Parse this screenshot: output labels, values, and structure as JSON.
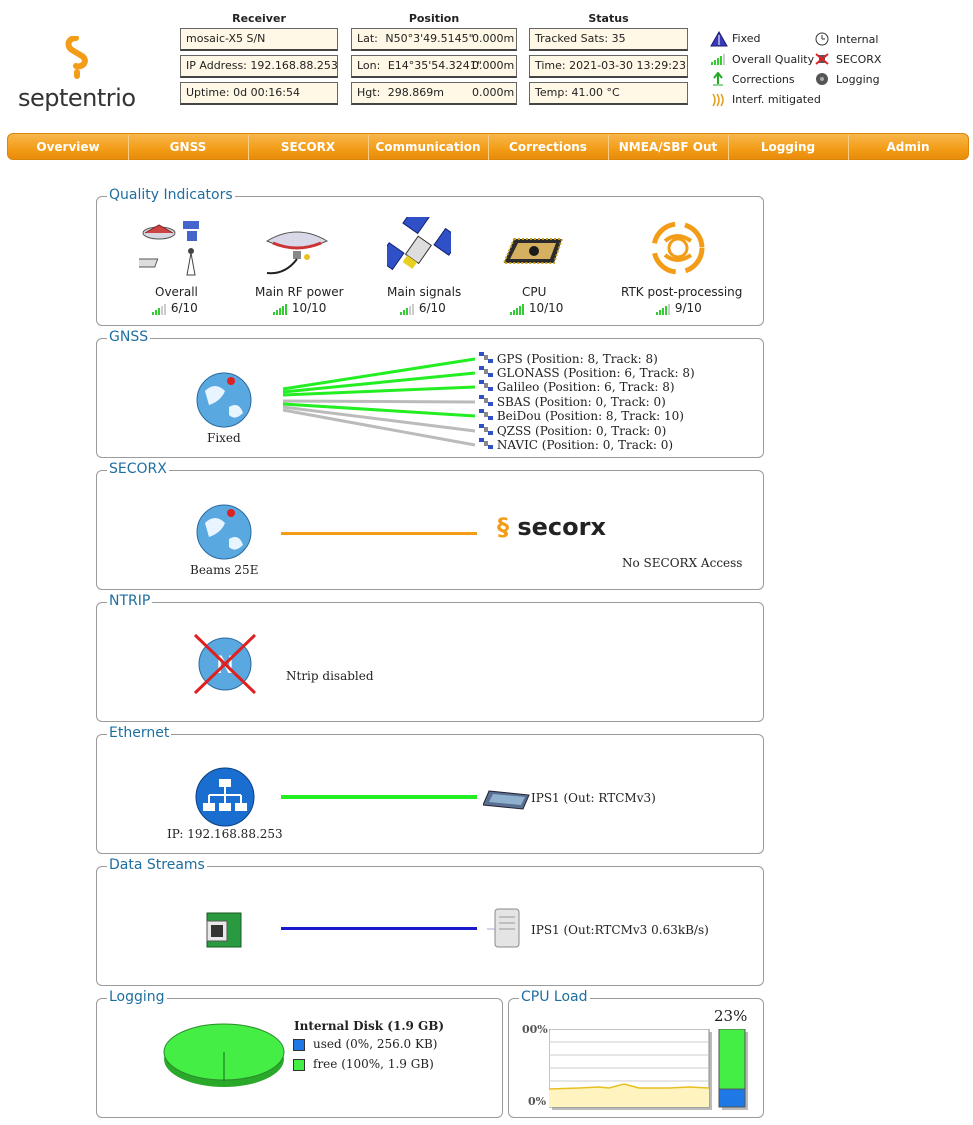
{
  "header": {
    "brand": "septentrio",
    "receiver": {
      "title": "Receiver",
      "rows": [
        "mosaic-X5 S/N",
        "IP Address: 192.168.88.253",
        "Uptime: 0d 00:16:54"
      ]
    },
    "position": {
      "title": "Position",
      "rows": [
        {
          "label": "Lat:",
          "value": "N50°3'49.5145\"",
          "acc": "0.000m"
        },
        {
          "label": "Lon:",
          "value": "E14°35'54.3241\"",
          "acc": "0.000m"
        },
        {
          "label": "Hgt:",
          "value": "298.869m",
          "acc": "0.000m"
        }
      ]
    },
    "status": {
      "title": "Status",
      "rows": [
        "Tracked Sats: 35",
        "Time: 2021-03-30 13:29:23",
        "Temp: 41.00 °C"
      ]
    },
    "legend": {
      "fixed": "Fixed",
      "overall_quality": "Overall Quality",
      "corrections": "Corrections",
      "interf_mitigated": "Interf. mitigated",
      "internal": "Internal",
      "secorx": "SECORX",
      "logging": "Logging"
    }
  },
  "nav": [
    "Overview",
    "GNSS",
    "SECORX",
    "Communication",
    "Corrections",
    "NMEA/SBF Out",
    "Logging",
    "Admin"
  ],
  "quality": {
    "title": "Quality Indicators",
    "items": [
      {
        "label": "Overall",
        "score": "6/10",
        "level": 6
      },
      {
        "label": "Main RF power",
        "score": "10/10",
        "level": 10
      },
      {
        "label": "Main signals",
        "score": "6/10",
        "level": 6
      },
      {
        "label": "CPU",
        "score": "10/10",
        "level": 10
      },
      {
        "label": "RTK post-processing",
        "score": "9/10",
        "level": 9
      }
    ]
  },
  "gnss": {
    "title": "GNSS",
    "mode": "Fixed",
    "constellations": [
      "GPS (Position: 8, Track: 8)",
      "GLONASS (Position: 6, Track: 8)",
      "Galileo (Position: 6, Track: 8)",
      "SBAS (Position: 0, Track: 0)",
      "BeiDou (Position: 8, Track: 10)",
      "QZSS (Position: 0, Track: 0)",
      "NAVIC (Position: 0, Track: 0)"
    ]
  },
  "secorx": {
    "title": "SECORX",
    "beams": "Beams 25E",
    "logo": "secorx",
    "access": "No SECORX Access"
  },
  "ntrip": {
    "title": "NTRIP",
    "status": "Ntrip disabled"
  },
  "ethernet": {
    "title": "Ethernet",
    "ip": "IP: 192.168.88.253",
    "port": "IPS1 (Out: RTCMv3)"
  },
  "streams": {
    "title": "Data Streams",
    "stream": "IPS1 (Out:RTCMv3 0.63kB/s)"
  },
  "logging": {
    "title": "Logging",
    "disk_title": "Internal Disk (1.9 GB)",
    "used": "used (0%, 256.0 KB)",
    "free": "free (100%, 1.9 GB)",
    "used_color": "#1e78e6",
    "free_color": "#44ee44"
  },
  "cpu": {
    "title": "CPU Load",
    "percent": "23%",
    "load_fraction": 0.23,
    "axis_top": "00%",
    "axis_bottom": "0%"
  }
}
